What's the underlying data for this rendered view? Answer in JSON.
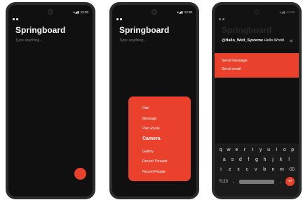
{
  "status_bar": {
    "time": "12:30",
    "signal_icons": "▾◢▮"
  },
  "app": {
    "title": "Springboard",
    "placeholder": "Type anything..."
  },
  "menu": {
    "items": [
      {
        "label": "Dial"
      },
      {
        "label": "Message"
      },
      {
        "label": "Plan Route"
      },
      {
        "label": "Camera"
      },
      {
        "label": "Gallery"
      },
      {
        "label": "Recent Threads"
      },
      {
        "label": "Recent People"
      }
    ]
  },
  "compose": {
    "mention": "@Hallo_Welt_Systeme",
    "text": " Hello World",
    "close_glyph": "✕",
    "actions": [
      {
        "label": "Send message"
      },
      {
        "label": "Send email"
      }
    ]
  },
  "keyboard": {
    "row1": [
      "q",
      "w",
      "e",
      "r",
      "t",
      "y",
      "u",
      "i",
      "o",
      "p"
    ],
    "row2": [
      "a",
      "s",
      "d",
      "f",
      "g",
      "h",
      "j",
      "k",
      "l"
    ],
    "row3": [
      "⇧",
      "z",
      "x",
      "c",
      "v",
      "b",
      "n",
      "m",
      "⌫"
    ],
    "row4_left": "?123",
    "row4_comma": ",",
    "row4_period": ".",
    "enter_glyph": "↵"
  },
  "colors": {
    "accent": "#e9412b",
    "background": "#101010",
    "frame": "#2c2c2c"
  }
}
